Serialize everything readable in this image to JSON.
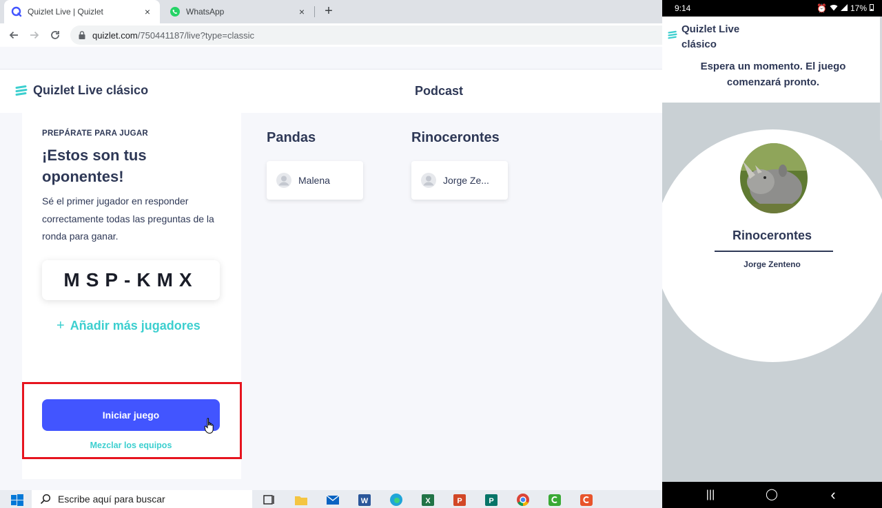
{
  "browser": {
    "tabs": [
      {
        "title": "Quizlet Live | Quizlet",
        "active": true,
        "favicon": "quizlet-icon"
      },
      {
        "title": "WhatsApp",
        "active": false,
        "favicon": "whatsapp-icon"
      }
    ],
    "new_tab_label": "+",
    "close_label": "×",
    "address": {
      "host": "quizlet.com",
      "path": "/750441187/live?type=classic"
    }
  },
  "page": {
    "brand": "Quizlet Live clásico",
    "set_name": "Podcast",
    "left_card": {
      "kicker": "PREPÁRATE PARA JUGAR",
      "heading": "¡Estos son tus oponentes!",
      "description": "Sé el primer jugador en responder correctamente todas las preguntas de la ronda para ganar.",
      "join_code": "MSP-KMX",
      "add_players_label": "Añadir más jugadores",
      "start_button": "Iniciar juego",
      "shuffle_label": "Mezclar los equipos"
    },
    "teams": [
      {
        "name": "Pandas",
        "players": [
          "Malena"
        ]
      },
      {
        "name": "Rinocerontes",
        "players": [
          "Jorge Ze..."
        ]
      }
    ]
  },
  "taskbar": {
    "search_placeholder": "Escribe aquí para buscar",
    "apps": [
      "windows-start-icon",
      "task-view-icon",
      "file-explorer-icon",
      "mail-icon",
      "word-icon",
      "edge-icon",
      "excel-icon",
      "powerpoint-icon",
      "publisher-icon",
      "chrome-icon",
      "camtasia-icon",
      "camtasia-recorder-icon"
    ]
  },
  "phone": {
    "status": {
      "time": "9:14",
      "battery": "17%"
    },
    "brand": "Quizlet Live clásico",
    "waiting_message": "Espera un momento. El juego comenzará pronto.",
    "team_name": "Rinocerontes",
    "player_name": "Jorge Zenteno",
    "nav": {
      "recents": "|||",
      "home": "◯",
      "back": "‹"
    }
  },
  "colors": {
    "primary": "#4255ff",
    "accent_teal": "#3ccfcf",
    "text_dark": "#2e3856",
    "page_bg": "#f6f7fb",
    "highlight_red": "#e6141e"
  }
}
